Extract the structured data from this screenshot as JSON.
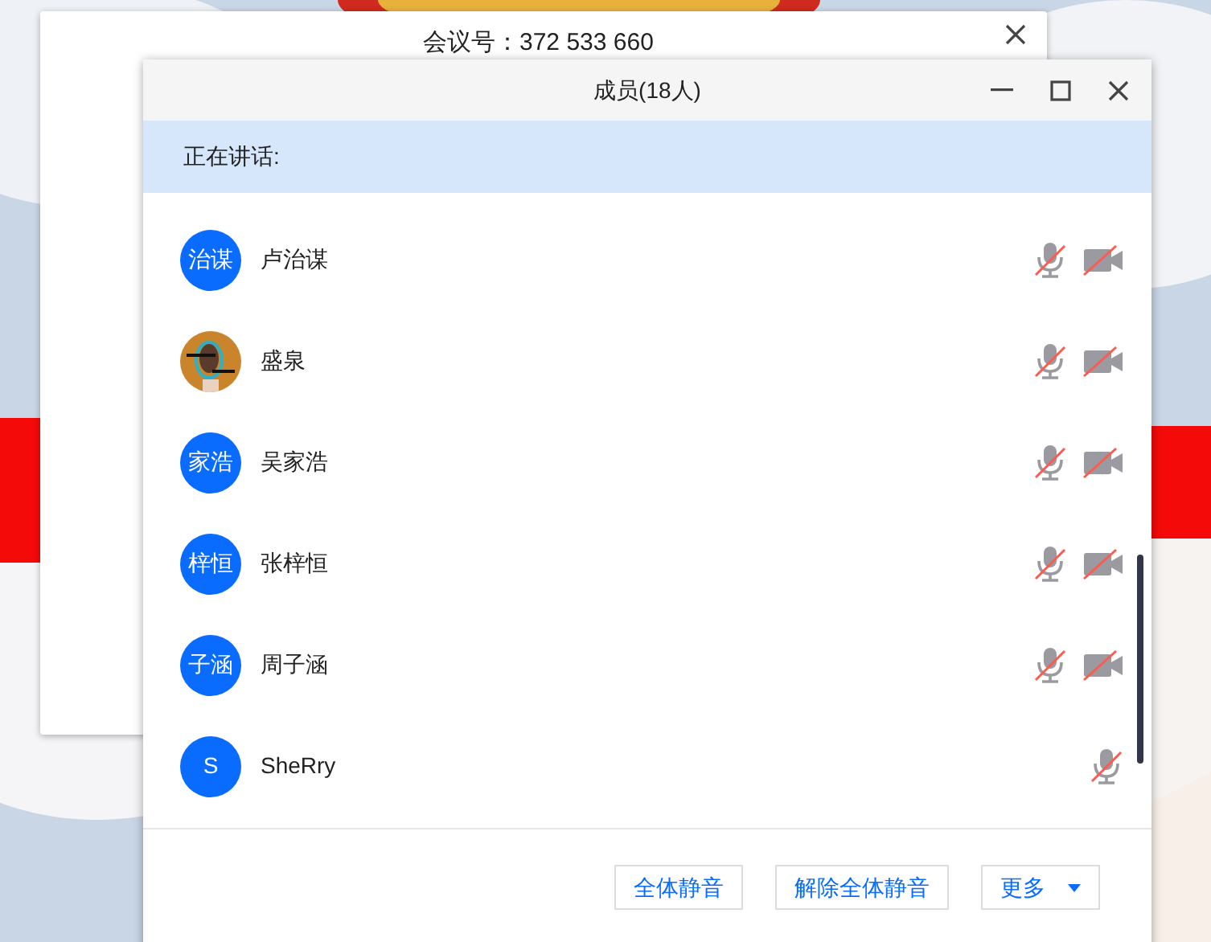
{
  "back_window": {
    "title": "会议号：372 533 660"
  },
  "window": {
    "title": "成员(18人)"
  },
  "speaking": {
    "label": "正在讲话:"
  },
  "members": [
    {
      "name": "卢治谋",
      "avatar": {
        "kind": "initials",
        "text": "治谋"
      },
      "mic_muted": true,
      "camera": {
        "muted": true
      }
    },
    {
      "name": "盛泉",
      "mic_muted": true,
      "camera": {
        "muted": true
      }
    },
    {
      "name": "吴家浩",
      "avatar": {
        "kind": "initials",
        "text": "家浩"
      },
      "mic_muted": true,
      "camera": {
        "muted": true
      }
    },
    {
      "name": "张梓恒",
      "avatar": {
        "kind": "initials",
        "text": "梓恒"
      },
      "mic_muted": true,
      "camera": {
        "muted": true
      }
    },
    {
      "name": "周子涵",
      "avatar": {
        "kind": "initials",
        "text": "子涵"
      },
      "mic_muted": true,
      "camera": {
        "muted": true
      }
    },
    {
      "name": "SheRry",
      "avatar": {
        "kind": "initials",
        "text": "S"
      },
      "mic_muted": true
    }
  ],
  "buttons": [
    {
      "label": "全体静音",
      "kind": "plain"
    },
    {
      "label": "解除全体静音",
      "kind": "plain"
    },
    {
      "label": "更多",
      "kind": "dropdown"
    }
  ]
}
